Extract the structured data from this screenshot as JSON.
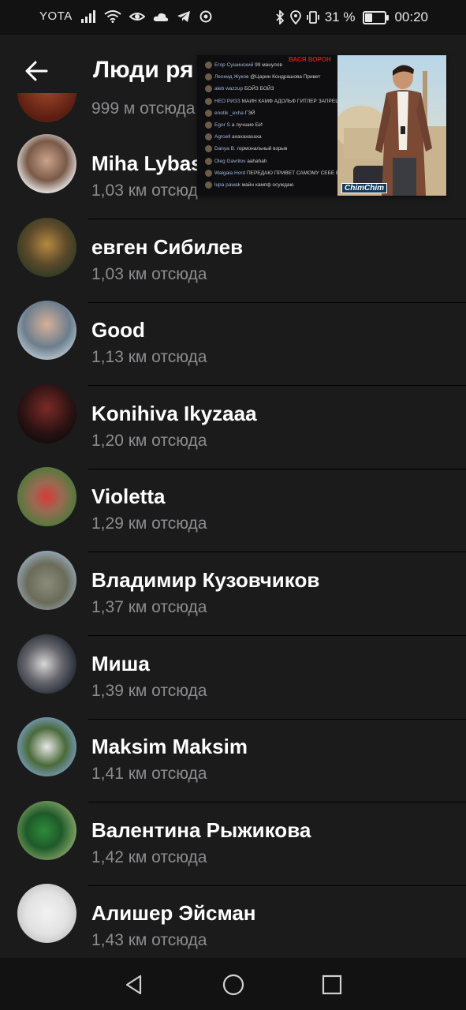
{
  "status_bar": {
    "carrier": "YOTA",
    "battery_percent": "31 %",
    "time": "00:20",
    "battery_level": 0.31
  },
  "header": {
    "title": "Люди ря",
    "back_icon": "arrow-left-icon"
  },
  "partial_item": {
    "distance": "999 м отсюда"
  },
  "people": [
    {
      "name": "Miha Lybas",
      "distance": "1,03 км отсюда"
    },
    {
      "name": "евген Сибилев",
      "distance": "1,03 км отсюда"
    },
    {
      "name": "Good",
      "distance": "1,13 км отсюда"
    },
    {
      "name": "Konihiva Ikyzaaa",
      "distance": "1,20 км отсюда"
    },
    {
      "name": "Violetta",
      "distance": "1,29 км отсюда"
    },
    {
      "name": "Владимир Кузовчиков",
      "distance": "1,37 км отсюда"
    },
    {
      "name": "Миша",
      "distance": "1,39 км отсюда"
    },
    {
      "name": "Maksim Maksim",
      "distance": "1,41 км отсюда"
    },
    {
      "name": "Валентина Рыжикова",
      "distance": "1,42 км отсюда"
    },
    {
      "name": "Алишер Эйсман",
      "distance": "1,43 км отсюда"
    }
  ],
  "video_overlay": {
    "title": "ВАСЯ ВОРОН",
    "badge": "ChimChim",
    "chat": [
      {
        "user": "Егор Сушинский",
        "text": "99 манулов"
      },
      {
        "user": "Леонид Жуков",
        "text": "@Царин Кондрашова Привет"
      },
      {
        "user": "aleb wazzup",
        "text": "БОЙЗ БОЙЗ"
      },
      {
        "user": "НЕО РИЗЗ",
        "text": "МАИН КАМФ АДОЛЬФ ГИТЛЕР ЗАПРЕЩЁННАЯ ЛИТЕРАТУРА"
      },
      {
        "user": "enotik _exha",
        "text": "ГЭЙ"
      },
      {
        "user": "Egor S",
        "text": "а лучшие БИ"
      },
      {
        "user": "Agroell",
        "text": "ахахахахаха"
      },
      {
        "user": "Danya B.",
        "text": "гормональный взрыв"
      },
      {
        "user": "Oleg Gavrilov",
        "text": "аahahah"
      },
      {
        "user": "Walgala Hord",
        "text": "ПЕРЕДАЮ ПРИВЕТ САМОМУ СЕБЕ В НАРЕЗКЕ"
      },
      {
        "user": "lupa pawak",
        "text": "майн кампф осуждаю"
      }
    ]
  },
  "colors": {
    "background": "#1b1b1c",
    "secondary_text": "#8c8c8e",
    "system_bar": "#121213"
  }
}
